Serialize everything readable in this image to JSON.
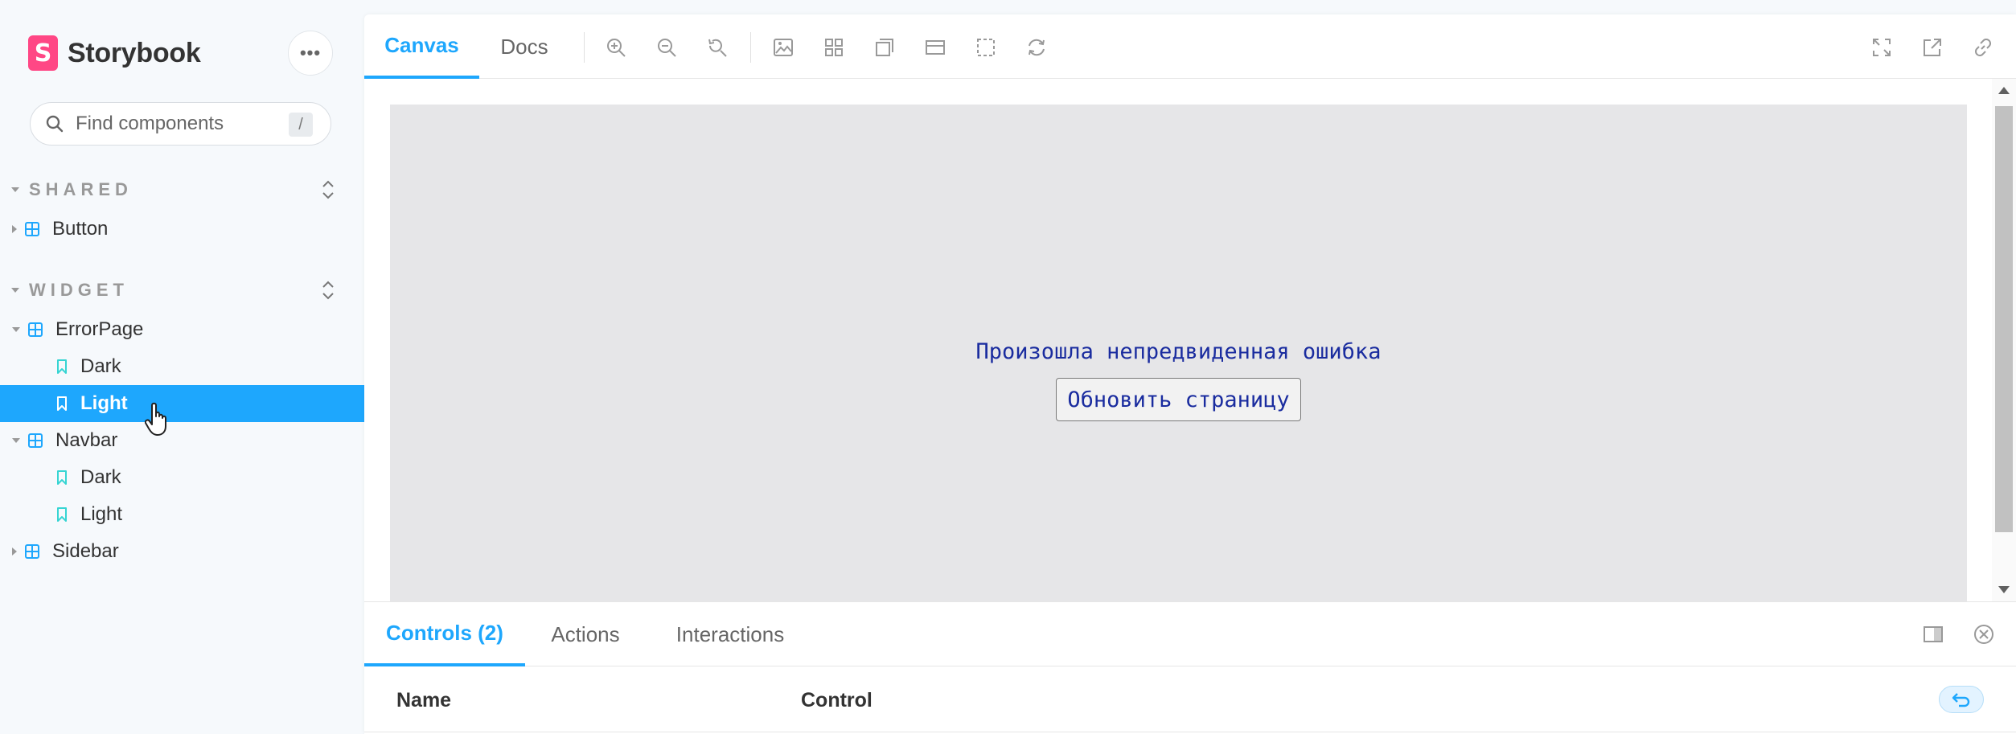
{
  "brand": {
    "logo_letter": "S",
    "name": "Storybook",
    "logo_color": "#ff4785"
  },
  "sidebar": {
    "more_label": "•••",
    "search": {
      "placeholder": "Find components",
      "shortcut": "/"
    },
    "groups": [
      {
        "title": "SHARED",
        "items": [
          {
            "label": "Button"
          }
        ]
      },
      {
        "title": "WIDGET",
        "items": [
          {
            "label": "ErrorPage",
            "children": [
              {
                "label": "Dark"
              },
              {
                "label": "Light",
                "selected": true
              }
            ]
          },
          {
            "label": "Navbar",
            "children": [
              {
                "label": "Dark"
              },
              {
                "label": "Light"
              }
            ]
          },
          {
            "label": "Sidebar"
          }
        ]
      }
    ]
  },
  "toolbar": {
    "tabs": [
      {
        "label": "Canvas",
        "active": true
      },
      {
        "label": "Docs"
      }
    ],
    "icons": [
      "zoom-in-icon",
      "zoom-out-icon",
      "zoom-reset-icon",
      "background-icon",
      "grid-icon",
      "outline-icon",
      "viewport-icon",
      "measure-icon",
      "remount-icon",
      "fullscreen-icon",
      "open-new-tab-icon",
      "copy-link-icon"
    ]
  },
  "canvas": {
    "error_message": "Произошла непредвиденная ошибка",
    "refresh_button": "Обновить страницу"
  },
  "addons": {
    "tabs": [
      {
        "label": "Controls (2)",
        "active": true
      },
      {
        "label": "Actions"
      },
      {
        "label": "Interactions"
      }
    ],
    "columns": {
      "name": "Name",
      "control": "Control"
    }
  },
  "colors": {
    "accent": "#1ea7fd",
    "canvas_bg": "#e6e6e8",
    "error_text": "#1a2c9f"
  }
}
